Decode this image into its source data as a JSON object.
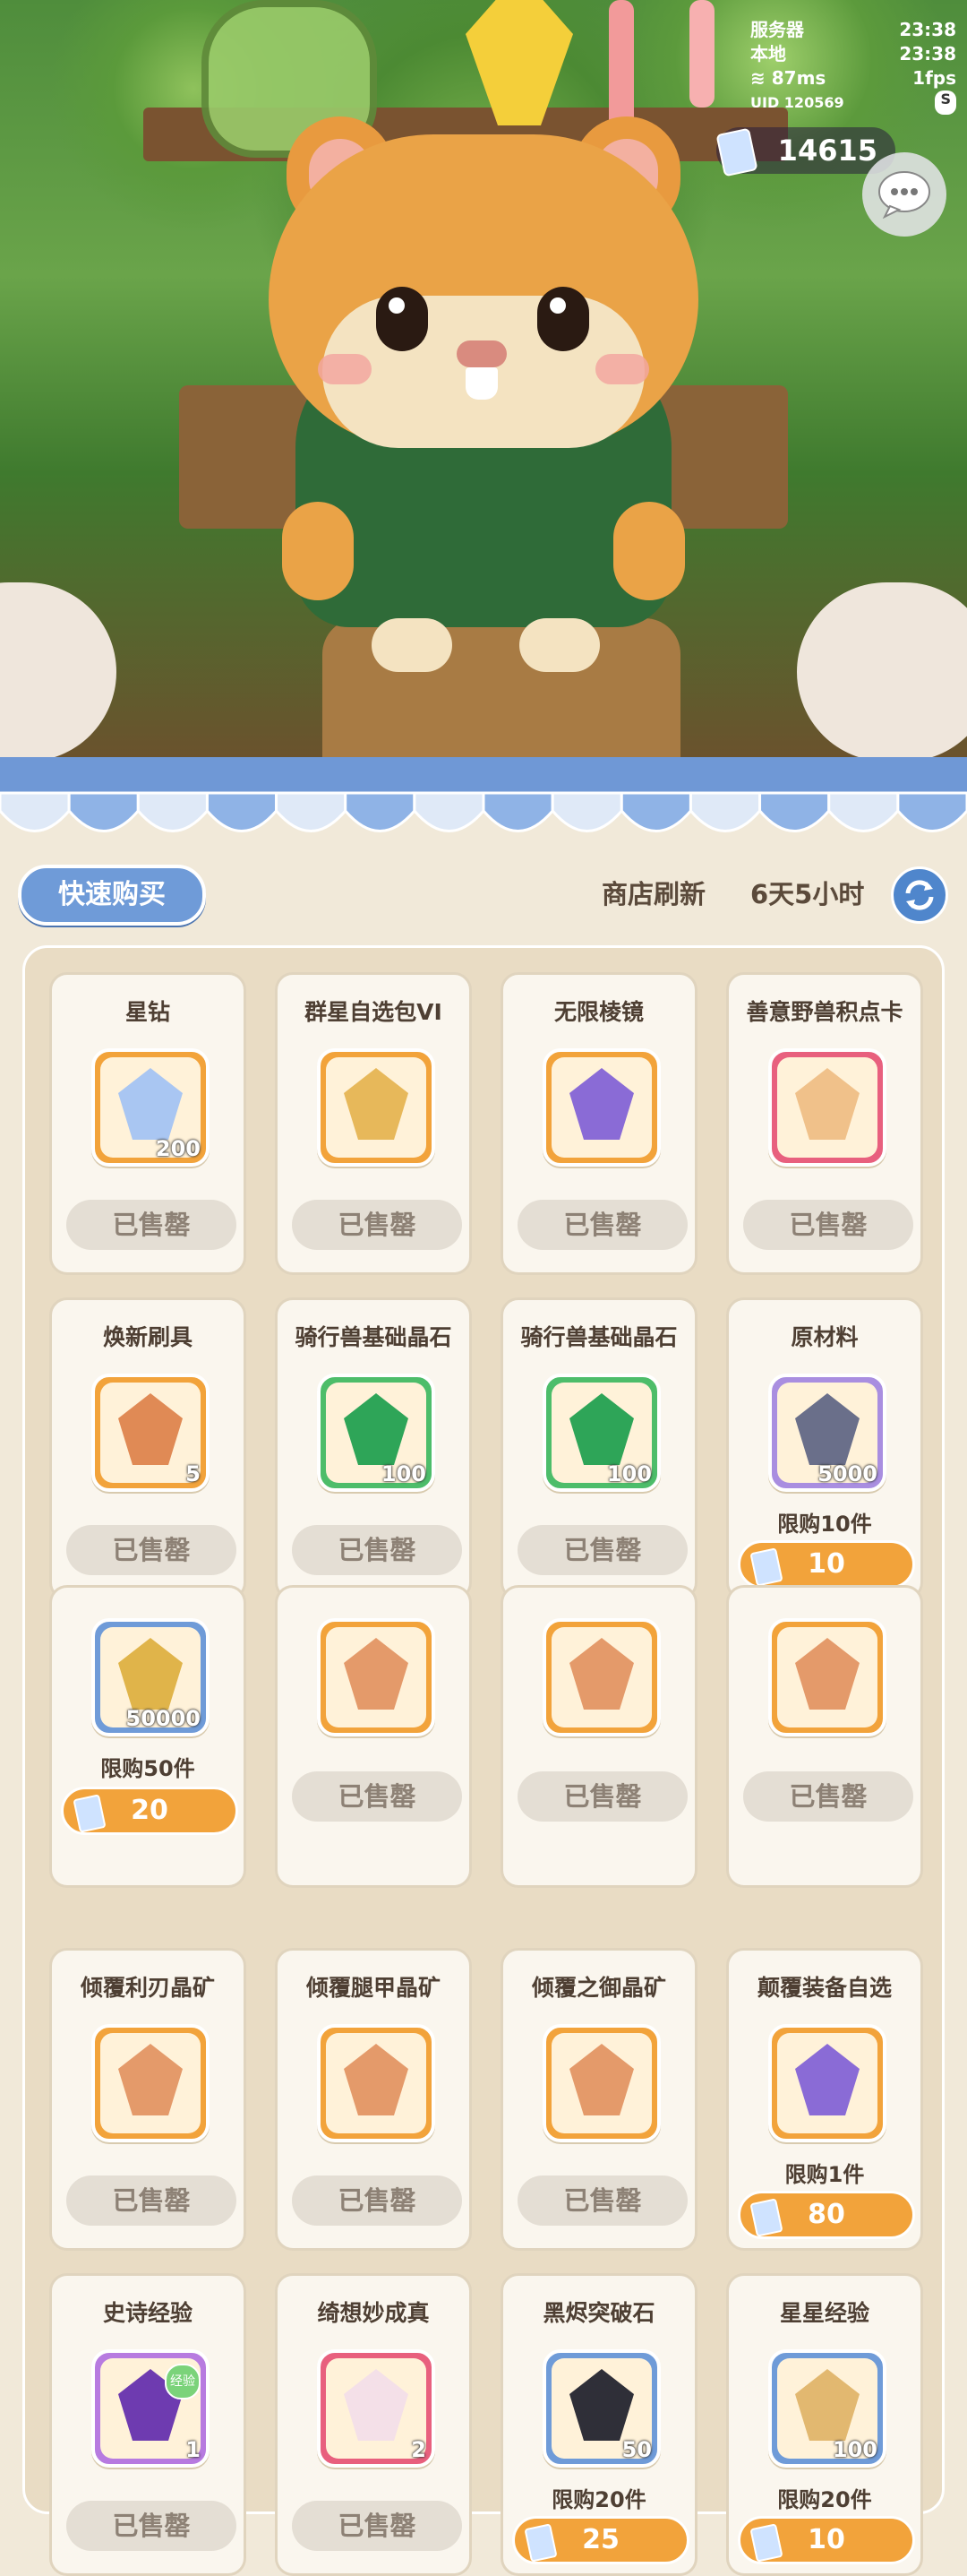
{
  "hud": {
    "server_label": "服务器",
    "server_time": "23:38",
    "local_label": "本地",
    "local_time": "23:38",
    "ping": "87ms",
    "fps": "1fps",
    "uid": "UID 120569",
    "uid_badge": "S"
  },
  "currency": {
    "amount": "14615",
    "icon": "ticket-icon"
  },
  "shop": {
    "quick_buy_label": "快速购买",
    "refresh_label": "商店刷新",
    "refresh_time": "6天5小时"
  },
  "items": [
    {
      "name": "星钻",
      "qty": "200",
      "limit": "",
      "price": "",
      "status": "已售罄",
      "icon": "star-diamond-icon",
      "color": "#f2a33b"
    },
    {
      "name": "群星自选包VI",
      "qty": "",
      "limit": "",
      "price": "",
      "status": "已售罄",
      "icon": "card-pack-icon",
      "color": "#f2a33b"
    },
    {
      "name": "无限棱镜",
      "qty": "",
      "limit": "",
      "price": "",
      "status": "已售罄",
      "icon": "prism-icon",
      "color": "#f2a33b"
    },
    {
      "name": "善意野兽积点卡",
      "qty": "",
      "limit": "",
      "price": "",
      "status": "已售罄",
      "icon": "fox-card-icon",
      "color": "#e8607e"
    },
    {
      "name": "焕新刷具",
      "qty": "5",
      "limit": "",
      "price": "",
      "status": "已售罄",
      "icon": "brush-icon",
      "color": "#f2a33b"
    },
    {
      "name": "骑行兽基础晶石",
      "qty": "100",
      "limit": "",
      "price": "",
      "status": "已售罄",
      "icon": "green-crystal-icon",
      "color": "#4dbd6a"
    },
    {
      "name": "骑行兽基础晶石",
      "qty": "100",
      "limit": "",
      "price": "",
      "status": "已售罄",
      "icon": "green-crystal-icon",
      "color": "#4dbd6a"
    },
    {
      "name": "原材料",
      "qty": "5000",
      "limit": "限购10件",
      "price": "10",
      "status": "",
      "icon": "ingot-icon",
      "color": "#a98ee0"
    },
    {
      "name": "",
      "qty": "50000",
      "limit": "限购50件",
      "price": "20",
      "status": "",
      "icon": "gold-coin-icon",
      "color": "#6f9bd8"
    },
    {
      "name": "",
      "qty": "",
      "limit": "",
      "price": "",
      "status": "已售罄",
      "icon": "ore-crystal-icon",
      "color": "#f2a33b"
    },
    {
      "name": "",
      "qty": "",
      "limit": "",
      "price": "",
      "status": "已售罄",
      "icon": "ore-crystal-icon",
      "color": "#f2a33b"
    },
    {
      "name": "",
      "qty": "",
      "limit": "",
      "price": "",
      "status": "已售罄",
      "icon": "ore-crystal-icon",
      "color": "#f2a33b"
    },
    {
      "name": "倾覆利刃晶矿",
      "qty": "",
      "limit": "",
      "price": "",
      "status": "已售罄",
      "icon": "ore-crystal-icon",
      "color": "#f2a33b"
    },
    {
      "name": "倾覆腿甲晶矿",
      "qty": "",
      "limit": "",
      "price": "",
      "status": "已售罄",
      "icon": "ore-crystal-icon",
      "color": "#f2a33b"
    },
    {
      "name": "倾覆之御晶矿",
      "qty": "",
      "limit": "",
      "price": "",
      "status": "已售罄",
      "icon": "ore-crystal-icon",
      "color": "#f2a33b"
    },
    {
      "name": "颠覆装备自选",
      "qty": "",
      "limit": "限购1件",
      "price": "80",
      "status": "",
      "icon": "treasure-chest-icon",
      "color": "#f2a33b"
    },
    {
      "name": "史诗经验",
      "qty": "1",
      "limit": "",
      "price": "",
      "status": "已售罄",
      "icon": "epic-exp-icon",
      "color": "#b77be0",
      "badge": "经验"
    },
    {
      "name": "绮想妙成真",
      "qty": "2",
      "limit": "",
      "price": "",
      "status": "已售罄",
      "icon": "cat-icon",
      "color": "#e8607e"
    },
    {
      "name": "黑烬突破石",
      "qty": "50",
      "limit": "限购20件",
      "price": "25",
      "status": "",
      "icon": "black-stone-icon",
      "color": "#6f9bd8"
    },
    {
      "name": "星星经验",
      "qty": "100",
      "limit": "限购20件",
      "price": "10",
      "status": "",
      "icon": "star-card-icon",
      "color": "#6f9bd8"
    }
  ]
}
